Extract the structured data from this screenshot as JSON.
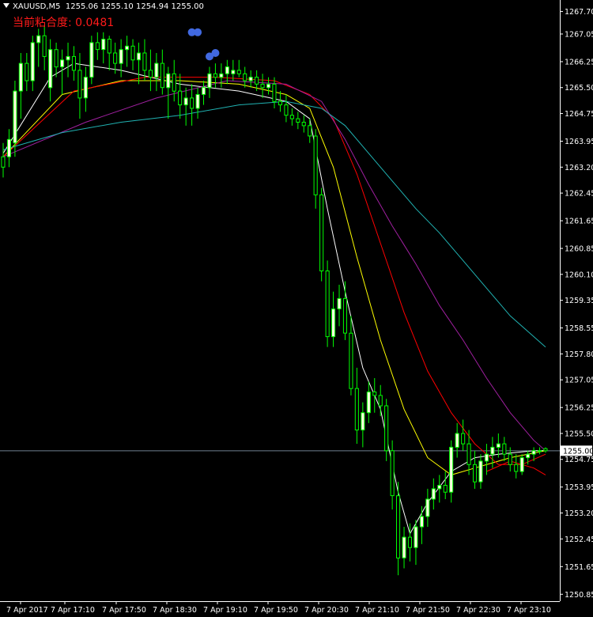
{
  "header": {
    "symbol": "XAUUSD,M5",
    "ohlc": "1255.06 1255.10 1254.94 1255.00"
  },
  "indicator": {
    "label": "当前粘合度: 0.0481"
  },
  "colors": {
    "background": "#000000",
    "axis": "#ffffff",
    "bull_candle": "#ffffe0",
    "bear_candle": "#000000",
    "wick": "#00ff00",
    "ma_white": "#ffffff",
    "ma_yellow": "#ffff00",
    "ma_red": "#ff0000",
    "ma_magenta": "#a020a0",
    "ma_cyan": "#20b2b2",
    "marker": "#4169e1",
    "bid_line": "#708090"
  },
  "chart_data": {
    "type": "candlestick",
    "ylim": [
      1250.65,
      1267.85
    ],
    "y_ticks": [
      "1267.70",
      "1267.05",
      "1266.25",
      "1265.50",
      "1264.75",
      "1263.95",
      "1263.20",
      "1262.45",
      "1261.65",
      "1260.85",
      "1260.10",
      "1259.35",
      "1258.55",
      "1257.80",
      "1257.05",
      "1256.25",
      "1255.50",
      "1254.75",
      "1253.95",
      "1253.20",
      "1252.45",
      "1251.65",
      "1250.85"
    ],
    "x_ticks": [
      "7 Apr 2017",
      "7 Apr 17:10",
      "7 Apr 17:50",
      "7 Apr 18:30",
      "7 Apr 19:10",
      "7 Apr 19:50",
      "7 Apr 20:30",
      "7 Apr 21:10",
      "7 Apr 21:50",
      "7 Apr 22:30",
      "7 Apr 23:10"
    ],
    "current_price": "1255.00",
    "candles": [
      [
        1263.5,
        1263.9,
        1262.9,
        1263.2
      ],
      [
        1263.5,
        1264.3,
        1263.2,
        1264.0
      ],
      [
        1263.9,
        1265.7,
        1263.5,
        1265.4
      ],
      [
        1265.4,
        1266.5,
        1264.6,
        1266.2
      ],
      [
        1266.2,
        1266.5,
        1265.4,
        1265.7
      ],
      [
        1265.7,
        1267.0,
        1265.4,
        1266.8
      ],
      [
        1266.8,
        1267.2,
        1266.1,
        1267.0
      ],
      [
        1267.0,
        1267.3,
        1266.0,
        1266.4
      ],
      [
        1265.5,
        1266.9,
        1265.1,
        1266.6
      ],
      [
        1266.6,
        1266.8,
        1265.8,
        1266.1
      ],
      [
        1266.1,
        1266.6,
        1265.3,
        1266.3
      ],
      [
        1266.3,
        1266.8,
        1265.8,
        1266.4
      ],
      [
        1266.4,
        1266.7,
        1265.7,
        1266.0
      ],
      [
        1266.0,
        1266.5,
        1264.6,
        1265.2
      ],
      [
        1265.2,
        1266.1,
        1264.8,
        1265.8
      ],
      [
        1265.8,
        1267.0,
        1265.6,
        1266.8
      ],
      [
        1266.8,
        1267.1,
        1266.3,
        1266.6
      ],
      [
        1266.6,
        1267.1,
        1266.2,
        1266.9
      ],
      [
        1266.9,
        1267.0,
        1266.0,
        1266.5
      ],
      [
        1266.5,
        1266.8,
        1265.9,
        1266.2
      ],
      [
        1266.2,
        1266.9,
        1265.8,
        1266.6
      ],
      [
        1266.6,
        1267.0,
        1266.1,
        1266.7
      ],
      [
        1266.7,
        1266.9,
        1266.0,
        1266.3
      ],
      [
        1266.3,
        1266.8,
        1265.6,
        1266.5
      ],
      [
        1266.5,
        1266.9,
        1265.7,
        1266.0
      ],
      [
        1266.0,
        1266.6,
        1265.4,
        1265.8
      ],
      [
        1265.8,
        1266.5,
        1265.4,
        1266.2
      ],
      [
        1266.2,
        1266.6,
        1265.3,
        1265.5
      ],
      [
        1265.5,
        1266.1,
        1264.6,
        1265.9
      ],
      [
        1265.9,
        1266.3,
        1265.1,
        1265.4
      ],
      [
        1265.4,
        1265.9,
        1264.6,
        1265.0
      ],
      [
        1265.0,
        1265.5,
        1264.4,
        1265.2
      ],
      [
        1265.2,
        1265.6,
        1264.4,
        1264.9
      ],
      [
        1264.9,
        1265.5,
        1264.6,
        1265.3
      ],
      [
        1265.3,
        1265.7,
        1265.0,
        1265.5
      ],
      [
        1265.5,
        1266.1,
        1265.2,
        1265.9
      ],
      [
        1265.9,
        1266.2,
        1265.5,
        1265.8
      ],
      [
        1265.8,
        1266.2,
        1265.5,
        1265.9
      ],
      [
        1265.9,
        1266.3,
        1265.6,
        1266.1
      ],
      [
        1265.9,
        1266.3,
        1265.7,
        1266.0
      ],
      [
        1266.0,
        1266.3,
        1265.8,
        1265.9
      ],
      [
        1265.9,
        1266.1,
        1265.5,
        1265.7
      ],
      [
        1265.7,
        1266.0,
        1265.5,
        1265.8
      ],
      [
        1265.8,
        1266.0,
        1265.4,
        1265.6
      ],
      [
        1265.6,
        1265.9,
        1265.2,
        1265.5
      ],
      [
        1265.5,
        1265.8,
        1265.3,
        1265.6
      ],
      [
        1265.6,
        1265.8,
        1264.9,
        1265.1
      ],
      [
        1265.1,
        1265.4,
        1264.8,
        1265.0
      ],
      [
        1265.0,
        1265.3,
        1264.5,
        1264.7
      ],
      [
        1264.7,
        1264.9,
        1264.4,
        1264.6
      ],
      [
        1264.6,
        1264.8,
        1264.3,
        1264.5
      ],
      [
        1264.5,
        1264.7,
        1264.2,
        1264.4
      ],
      [
        1264.4,
        1264.6,
        1263.9,
        1264.1
      ],
      [
        1264.1,
        1264.3,
        1262.0,
        1262.4
      ],
      [
        1262.4,
        1262.6,
        1259.9,
        1260.2
      ],
      [
        1260.2,
        1260.5,
        1258.0,
        1258.3
      ],
      [
        1258.3,
        1259.6,
        1258.0,
        1259.1
      ],
      [
        1259.1,
        1259.8,
        1258.6,
        1259.4
      ],
      [
        1259.4,
        1259.9,
        1258.2,
        1258.4
      ],
      [
        1258.4,
        1258.9,
        1256.6,
        1256.8
      ],
      [
        1256.8,
        1257.4,
        1255.2,
        1255.6
      ],
      [
        1255.6,
        1256.4,
        1255.1,
        1256.1
      ],
      [
        1256.1,
        1257.0,
        1255.8,
        1256.7
      ],
      [
        1256.7,
        1257.1,
        1256.1,
        1256.6
      ],
      [
        1256.6,
        1256.9,
        1256.0,
        1256.3
      ],
      [
        1256.3,
        1256.5,
        1254.7,
        1255.0
      ],
      [
        1255.0,
        1255.3,
        1253.3,
        1253.7
      ],
      [
        1253.7,
        1254.1,
        1251.4,
        1251.9
      ],
      [
        1251.9,
        1252.8,
        1251.6,
        1252.5
      ],
      [
        1252.5,
        1252.9,
        1251.8,
        1252.2
      ],
      [
        1252.2,
        1253.0,
        1251.7,
        1252.8
      ],
      [
        1252.8,
        1253.4,
        1252.3,
        1253.1
      ],
      [
        1253.1,
        1253.9,
        1252.8,
        1253.6
      ],
      [
        1253.6,
        1254.2,
        1253.3,
        1253.9
      ],
      [
        1253.9,
        1254.3,
        1253.5,
        1254.0
      ],
      [
        1254.0,
        1254.4,
        1253.6,
        1253.8
      ],
      [
        1253.8,
        1255.3,
        1253.5,
        1255.1
      ],
      [
        1255.1,
        1255.8,
        1254.8,
        1255.5
      ],
      [
        1255.5,
        1255.9,
        1255.0,
        1255.2
      ],
      [
        1255.2,
        1255.6,
        1254.3,
        1254.6
      ],
      [
        1254.6,
        1255.0,
        1253.9,
        1254.1
      ],
      [
        1254.1,
        1254.9,
        1253.9,
        1254.7
      ],
      [
        1254.7,
        1255.2,
        1254.3,
        1254.9
      ],
      [
        1254.9,
        1255.4,
        1254.5,
        1255.1
      ],
      [
        1255.1,
        1255.5,
        1254.8,
        1255.2
      ],
      [
        1255.2,
        1255.4,
        1254.7,
        1254.9
      ],
      [
        1254.9,
        1255.1,
        1254.4,
        1254.6
      ],
      [
        1254.6,
        1254.9,
        1254.2,
        1254.4
      ],
      [
        1254.4,
        1254.9,
        1254.3,
        1254.8
      ],
      [
        1254.8,
        1255.0,
        1254.6,
        1254.9
      ],
      [
        1254.9,
        1255.1,
        1254.7,
        1255.0
      ],
      [
        1255.0,
        1255.1,
        1254.9,
        1255.0
      ],
      [
        1255.06,
        1255.1,
        1254.94,
        1255.0
      ]
    ],
    "moving_averages": [
      {
        "color_key": "ma_white",
        "values": [
          [
            0,
            1263.6
          ],
          [
            8,
            1265.8
          ],
          [
            12,
            1266.2
          ],
          [
            20,
            1266.0
          ],
          [
            30,
            1265.6
          ],
          [
            40,
            1265.4
          ],
          [
            48,
            1265.1
          ],
          [
            52,
            1264.6
          ],
          [
            55,
            1262.0
          ],
          [
            58,
            1259.6
          ],
          [
            61,
            1257.4
          ],
          [
            64,
            1256.2
          ],
          [
            67,
            1253.8
          ],
          [
            69,
            1252.6
          ],
          [
            72,
            1253.5
          ],
          [
            76,
            1254.4
          ],
          [
            80,
            1254.8
          ],
          [
            84,
            1254.9
          ],
          [
            90,
            1255.0
          ],
          [
            92,
            1255.0
          ]
        ]
      },
      {
        "color_key": "ma_yellow",
        "values": [
          [
            0,
            1263.5
          ],
          [
            10,
            1265.3
          ],
          [
            20,
            1265.7
          ],
          [
            30,
            1265.7
          ],
          [
            40,
            1265.6
          ],
          [
            48,
            1265.3
          ],
          [
            52,
            1264.9
          ],
          [
            56,
            1263.2
          ],
          [
            60,
            1260.6
          ],
          [
            64,
            1258.2
          ],
          [
            68,
            1256.2
          ],
          [
            72,
            1254.8
          ],
          [
            76,
            1254.3
          ],
          [
            80,
            1254.5
          ],
          [
            86,
            1254.8
          ],
          [
            92,
            1255.0
          ]
        ]
      },
      {
        "color_key": "ma_red",
        "values": [
          [
            0,
            1263.5
          ],
          [
            12,
            1265.4
          ],
          [
            24,
            1265.8
          ],
          [
            36,
            1265.8
          ],
          [
            46,
            1265.7
          ],
          [
            52,
            1265.3
          ],
          [
            56,
            1264.6
          ],
          [
            60,
            1263.0
          ],
          [
            64,
            1261.0
          ],
          [
            68,
            1259.0
          ],
          [
            72,
            1257.3
          ],
          [
            76,
            1256.1
          ],
          [
            80,
            1255.2
          ],
          [
            84,
            1254.6
          ],
          [
            88,
            1254.6
          ],
          [
            92,
            1254.9
          ]
        ]
      },
      {
        "color_key": "ma_magenta",
        "values": [
          [
            0,
            1263.5
          ],
          [
            14,
            1264.5
          ],
          [
            26,
            1265.2
          ],
          [
            38,
            1265.7
          ],
          [
            48,
            1265.6
          ],
          [
            54,
            1265.1
          ],
          [
            58,
            1264.0
          ],
          [
            62,
            1262.7
          ],
          [
            66,
            1261.5
          ],
          [
            70,
            1260.4
          ],
          [
            74,
            1259.2
          ],
          [
            78,
            1258.2
          ],
          [
            82,
            1257.1
          ],
          [
            86,
            1256.1
          ],
          [
            90,
            1255.3
          ],
          [
            92,
            1255.0
          ]
        ]
      },
      {
        "color_key": "ma_cyan",
        "values": [
          [
            0,
            1263.7
          ],
          [
            10,
            1264.2
          ],
          [
            20,
            1264.5
          ],
          [
            30,
            1264.7
          ],
          [
            40,
            1265.0
          ],
          [
            48,
            1265.1
          ],
          [
            54,
            1264.9
          ],
          [
            58,
            1264.4
          ],
          [
            62,
            1263.6
          ],
          [
            66,
            1262.8
          ],
          [
            70,
            1262.0
          ],
          [
            74,
            1261.3
          ],
          [
            78,
            1260.5
          ],
          [
            82,
            1259.7
          ],
          [
            86,
            1258.9
          ],
          [
            92,
            1258.0
          ]
        ]
      },
      {
        "color_key": "ma_red",
        "name_hint": "lower_tail",
        "values": [
          [
            82,
            1254.4
          ],
          [
            86,
            1254.7
          ],
          [
            90,
            1254.5
          ],
          [
            92,
            1254.3
          ]
        ]
      }
    ],
    "markers": [
      [
        32,
        1267.1
      ],
      [
        33,
        1267.1
      ],
      [
        35,
        1266.4
      ],
      [
        36,
        1266.5
      ]
    ]
  }
}
